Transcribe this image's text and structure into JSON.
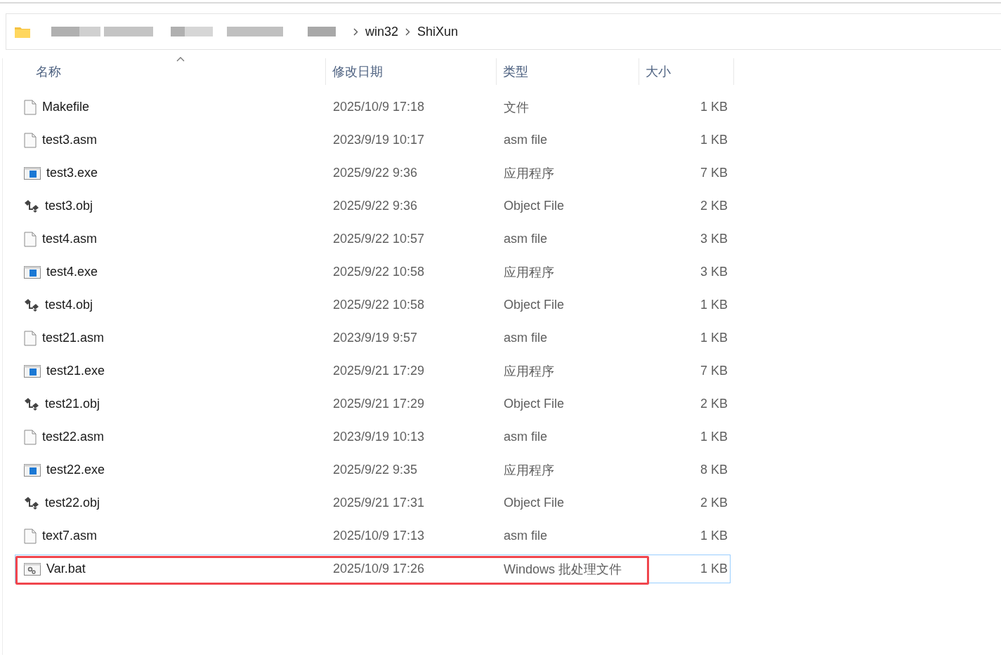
{
  "address_bar": {
    "segments": [
      "win32",
      "ShiXun"
    ]
  },
  "columns": [
    {
      "label": "名称",
      "sorted": true
    },
    {
      "label": "修改日期",
      "sorted": false
    },
    {
      "label": "类型",
      "sorted": false
    },
    {
      "label": "大小",
      "sorted": false
    }
  ],
  "files": [
    {
      "name": "Makefile",
      "date": "2025/10/9 17:18",
      "type": "文件",
      "size": "1 KB",
      "kind": "file",
      "selected": false,
      "annotated": false
    },
    {
      "name": "test3.asm",
      "date": "2023/9/19 10:17",
      "type": "asm file",
      "size": "1 KB",
      "kind": "file",
      "selected": false,
      "annotated": false
    },
    {
      "name": "test3.exe",
      "date": "2025/9/22 9:36",
      "type": "应用程序",
      "size": "7 KB",
      "kind": "exe",
      "selected": false,
      "annotated": false
    },
    {
      "name": "test3.obj",
      "date": "2025/9/22 9:36",
      "type": "Object File",
      "size": "2 KB",
      "kind": "obj",
      "selected": false,
      "annotated": false
    },
    {
      "name": "test4.asm",
      "date": "2025/9/22 10:57",
      "type": "asm file",
      "size": "3 KB",
      "kind": "file",
      "selected": false,
      "annotated": false
    },
    {
      "name": "test4.exe",
      "date": "2025/9/22 10:58",
      "type": "应用程序",
      "size": "3 KB",
      "kind": "exe",
      "selected": false,
      "annotated": false
    },
    {
      "name": "test4.obj",
      "date": "2025/9/22 10:58",
      "type": "Object File",
      "size": "1 KB",
      "kind": "obj",
      "selected": false,
      "annotated": false
    },
    {
      "name": "test21.asm",
      "date": "2023/9/19 9:57",
      "type": "asm file",
      "size": "1 KB",
      "kind": "file",
      "selected": false,
      "annotated": false
    },
    {
      "name": "test21.exe",
      "date": "2025/9/21 17:29",
      "type": "应用程序",
      "size": "7 KB",
      "kind": "exe",
      "selected": false,
      "annotated": false
    },
    {
      "name": "test21.obj",
      "date": "2025/9/21 17:29",
      "type": "Object File",
      "size": "2 KB",
      "kind": "obj",
      "selected": false,
      "annotated": false
    },
    {
      "name": "test22.asm",
      "date": "2023/9/19 10:13",
      "type": "asm file",
      "size": "1 KB",
      "kind": "file",
      "selected": false,
      "annotated": false
    },
    {
      "name": "test22.exe",
      "date": "2025/9/22 9:35",
      "type": "应用程序",
      "size": "8 KB",
      "kind": "exe",
      "selected": false,
      "annotated": false
    },
    {
      "name": "test22.obj",
      "date": "2025/9/21 17:31",
      "type": "Object File",
      "size": "2 KB",
      "kind": "obj",
      "selected": false,
      "annotated": false
    },
    {
      "name": "text7.asm",
      "date": "2025/10/9 17:13",
      "type": "asm file",
      "size": "1 KB",
      "kind": "file",
      "selected": false,
      "annotated": false
    },
    {
      "name": "Var.bat",
      "date": "2025/10/9 17:26",
      "type": "Windows 批处理文件",
      "size": "1 KB",
      "kind": "bat",
      "selected": true,
      "annotated": true
    }
  ]
}
